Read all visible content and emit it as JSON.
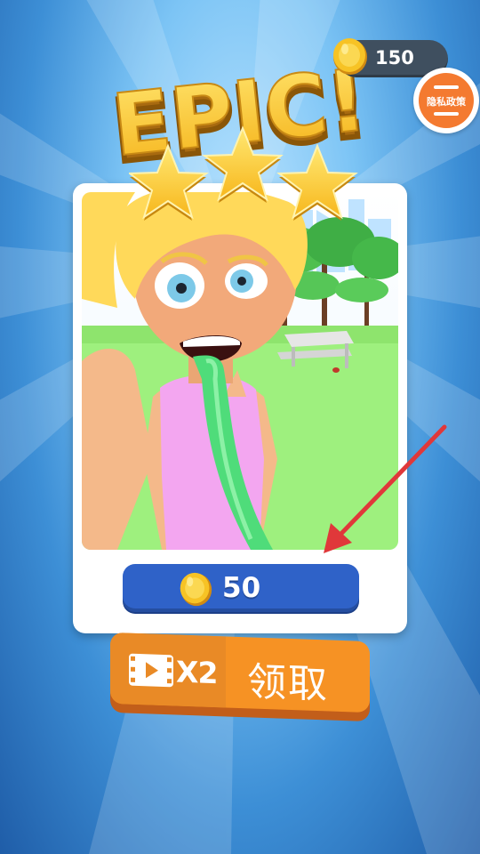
{
  "header": {
    "coins": "150",
    "privacy_label": "隐私政策"
  },
  "title": "EPIC!",
  "result": {
    "stars_earned": 3,
    "stars_total": 3
  },
  "reward": {
    "amount": "50"
  },
  "claim_button": {
    "multiplier": "X2",
    "label": "领取"
  },
  "colors": {
    "accent_orange": "#f69224",
    "reward_blue": "#2f62c8",
    "coin_gold": "#f7c325",
    "arrow_red": "#e0383a"
  }
}
